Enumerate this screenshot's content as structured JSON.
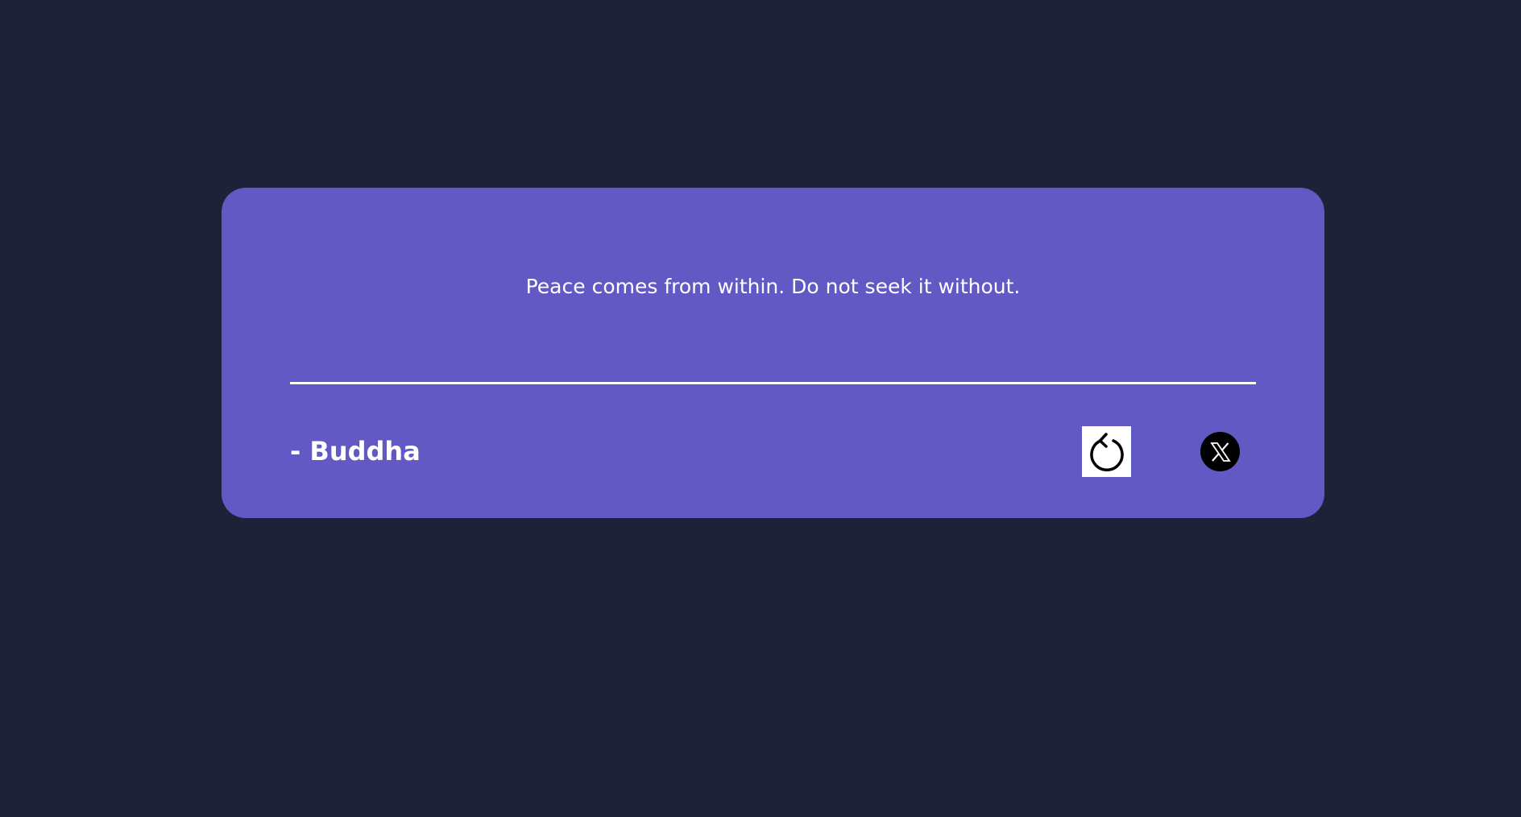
{
  "colors": {
    "background": "#1e2239",
    "card": "#6259c4",
    "text": "#ffffff",
    "refresh_button_bg": "#ffffff",
    "x_button_bg": "#000000"
  },
  "quote": {
    "text": "Peace comes from within. Do not seek it without.",
    "author": "- Buddha"
  },
  "actions": {
    "refresh_icon": "refresh-icon",
    "share_icon": "x-logo-icon"
  }
}
